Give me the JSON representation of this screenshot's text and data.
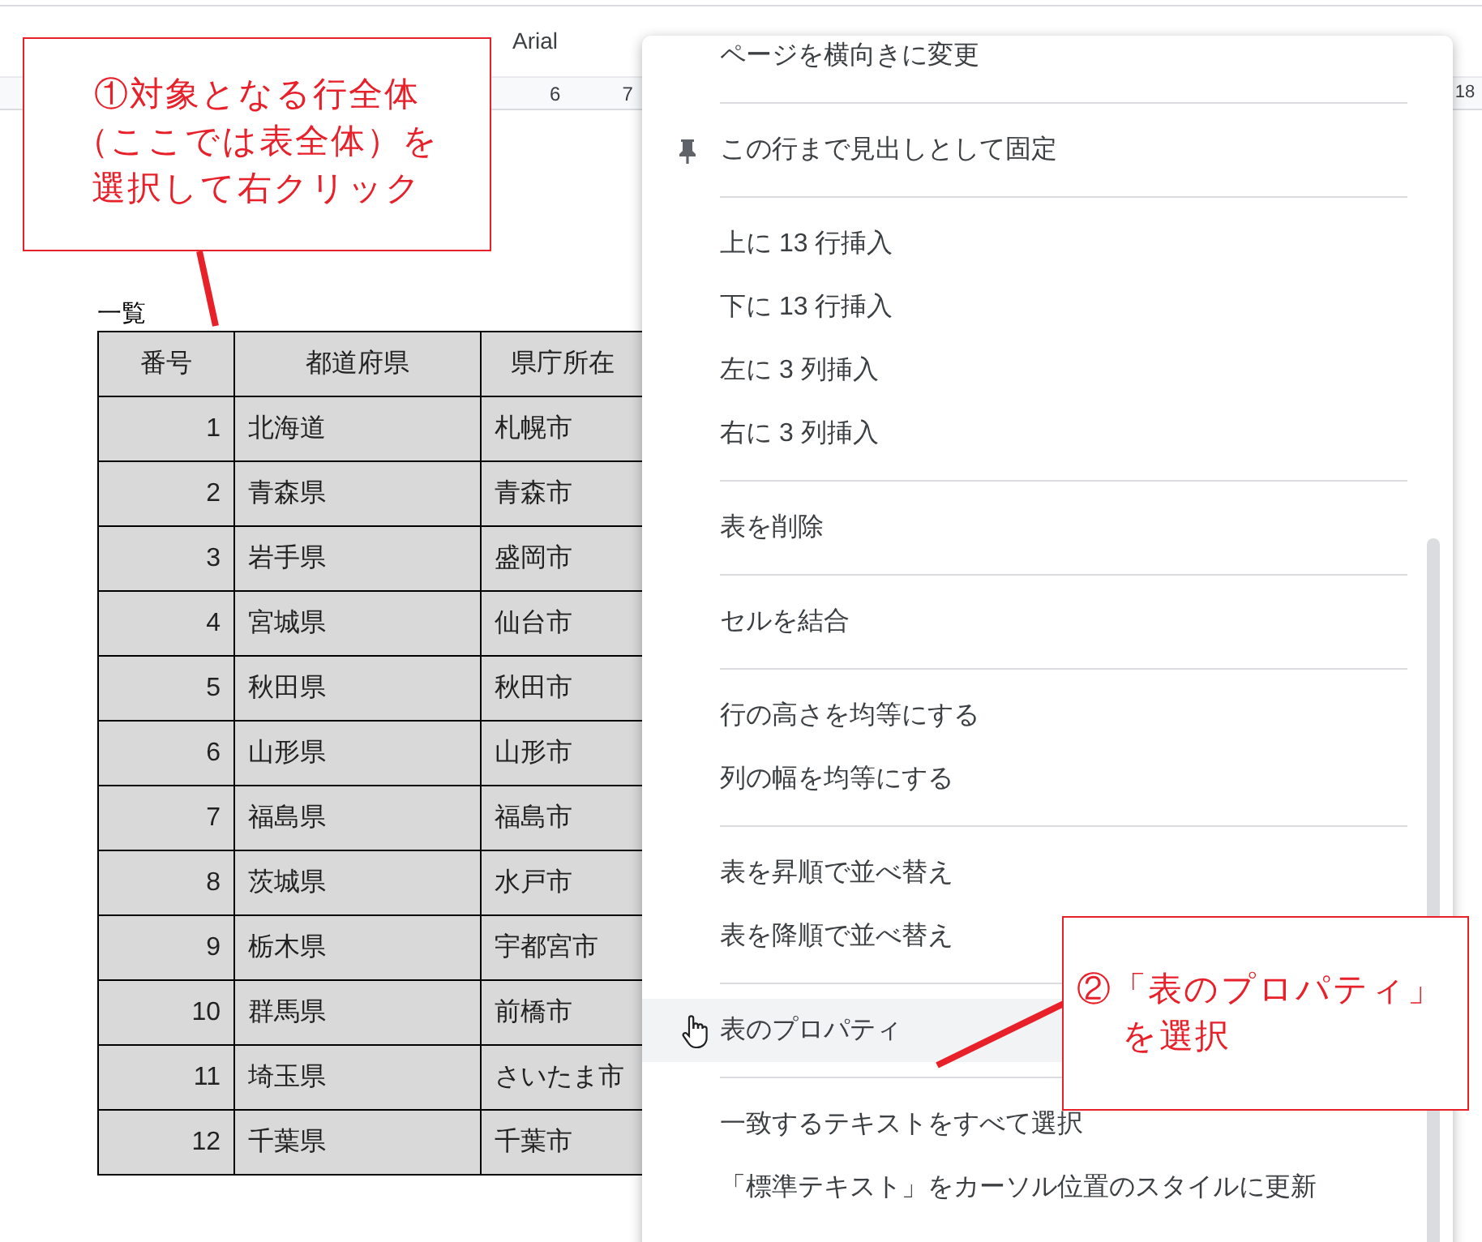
{
  "toolbar": {
    "font": "Arial"
  },
  "ruler": {
    "ticks": [
      "6",
      "7",
      "18"
    ]
  },
  "document": {
    "caption": "一覧",
    "table": {
      "columns": [
        "番号",
        "都道府県",
        "県庁所在"
      ],
      "rows": [
        [
          "1",
          "北海道",
          "札幌市"
        ],
        [
          "2",
          "青森県",
          "青森市"
        ],
        [
          "3",
          "岩手県",
          "盛岡市"
        ],
        [
          "4",
          "宮城県",
          "仙台市"
        ],
        [
          "5",
          "秋田県",
          "秋田市"
        ],
        [
          "6",
          "山形県",
          "山形市"
        ],
        [
          "7",
          "福島県",
          "福島市"
        ],
        [
          "8",
          "茨城県",
          "水戸市"
        ],
        [
          "9",
          "栃木県",
          "宇都宮市"
        ],
        [
          "10",
          "群馬県",
          "前橋市"
        ],
        [
          "11",
          "埼玉県",
          "さいたま市"
        ],
        [
          "12",
          "千葉県",
          "千葉市"
        ]
      ]
    }
  },
  "context_menu": {
    "sections": [
      [
        {
          "label": "ページを横向きに変更",
          "kind": "plain",
          "highlighted": false
        }
      ],
      [
        {
          "label": "この行まで見出しとして固定",
          "kind": "pin",
          "highlighted": false
        }
      ],
      [
        {
          "label": "上に 13 行挿入",
          "kind": "plain",
          "highlighted": false
        },
        {
          "label": "下に 13 行挿入",
          "kind": "plain",
          "highlighted": false
        },
        {
          "label": "左に 3 列挿入",
          "kind": "plain",
          "highlighted": false
        },
        {
          "label": "右に 3 列挿入",
          "kind": "plain",
          "highlighted": false
        }
      ],
      [
        {
          "label": "表を削除",
          "kind": "plain",
          "highlighted": false
        }
      ],
      [
        {
          "label": "セルを結合",
          "kind": "plain",
          "highlighted": false
        }
      ],
      [
        {
          "label": "行の高さを均等にする",
          "kind": "plain",
          "highlighted": false
        },
        {
          "label": "列の幅を均等にする",
          "kind": "plain",
          "highlighted": false
        }
      ],
      [
        {
          "label": "表を昇順で並べ替え",
          "kind": "plain",
          "highlighted": false
        },
        {
          "label": "表を降順で並べ替え",
          "kind": "plain",
          "highlighted": false
        }
      ],
      [
        {
          "label": "表のプロパティ",
          "kind": "plain",
          "highlighted": true
        }
      ],
      [
        {
          "label": "一致するテキストをすべて選択",
          "kind": "plain",
          "highlighted": false
        },
        {
          "label": "「標準テキスト」をカーソル位置のスタイルに更新",
          "kind": "plain",
          "highlighted": false
        }
      ]
    ]
  },
  "callouts": [
    {
      "lines": [
        "①対象となる行全体",
        "（ここでは表全体）を",
        "選択して右クリック"
      ]
    },
    {
      "lines": [
        "②「表のプロパティ」",
        "を選択"
      ]
    }
  ]
}
